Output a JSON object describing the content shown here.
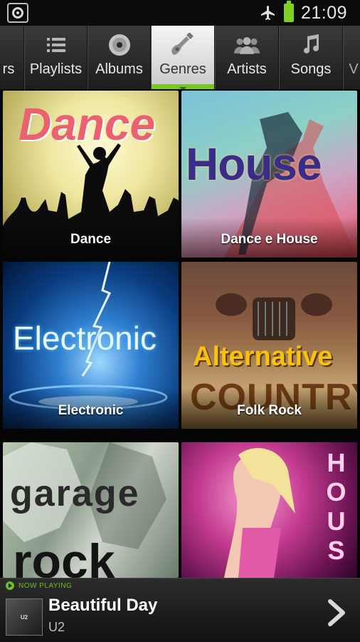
{
  "status_bar": {
    "time": "21:09",
    "icons": [
      "app-disc-icon",
      "airplane-mode-icon",
      "battery-icon"
    ],
    "battery_color": "#7fd320"
  },
  "tabs": [
    {
      "label": "rs",
      "icon": "person-icon"
    },
    {
      "label": "Playlists",
      "icon": "list-icon"
    },
    {
      "label": "Albums",
      "icon": "disc-icon"
    },
    {
      "label": "Genres",
      "icon": "guitar-icon",
      "active": true
    },
    {
      "label": "Artists",
      "icon": "people-icon"
    },
    {
      "label": "Songs",
      "icon": "music-note-icon"
    },
    {
      "label": "V",
      "icon": ""
    }
  ],
  "accent_color": "#7cc526",
  "genres": [
    {
      "caption": "Dance",
      "art_text": "Dance"
    },
    {
      "caption": "Dance e House",
      "art_text": "House"
    },
    {
      "caption": "Electronic",
      "art_text": "Electronic"
    },
    {
      "caption": "Folk Rock",
      "art_text_1": "Alternative",
      "art_text_2": "COUNTRY"
    },
    {
      "caption": "",
      "art_text_1": "garage",
      "art_text_2": "rock"
    },
    {
      "caption": "",
      "art_text": "HOUS"
    }
  ],
  "now_playing": {
    "header": "NOW PLAYING",
    "title": "Beautiful Day",
    "artist": "U2",
    "cover_text": "U2"
  }
}
